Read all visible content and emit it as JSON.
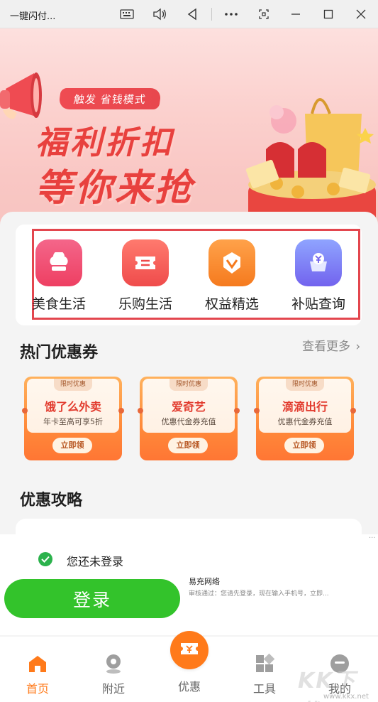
{
  "window": {
    "title": "一键闪付...",
    "buttons": [
      "keyboard-icon",
      "volume-icon",
      "back-icon",
      "more-icon",
      "screen-icon",
      "minimize-icon",
      "maximize-icon",
      "close-icon"
    ]
  },
  "banner": {
    "pill": "触发  省钱模式",
    "headline1": "福利折扣",
    "headline2": "等你来抢"
  },
  "quick_actions": [
    {
      "label": "美食生活",
      "icon": "chef-hat-icon",
      "color": "#f04a6c"
    },
    {
      "label": "乐购生活",
      "icon": "ticket-icon",
      "color": "#f25a54"
    },
    {
      "label": "权益精选",
      "icon": "badge-icon",
      "color": "#f7852a"
    },
    {
      "label": "补贴查询",
      "icon": "yuan-wallet-icon",
      "color": "#7a84f5"
    }
  ],
  "hot_coupons": {
    "title": "热门优惠券",
    "more": "查看更多",
    "items": [
      {
        "tag": "限时优惠",
        "name": "饿了么外卖",
        "desc": "年卡至高可享5折",
        "button": "立即领"
      },
      {
        "tag": "限时优惠",
        "name": "爱奇艺",
        "desc": "优惠代金券充值",
        "button": "立即领"
      },
      {
        "tag": "限时优惠",
        "name": "滴滴出行",
        "desc": "优惠代金券充值",
        "button": "立即领"
      }
    ]
  },
  "guide": {
    "title": "优惠攻略"
  },
  "login": {
    "status": "您还未登录",
    "button": "登录",
    "carrier": "易充网络",
    "note": "审核通过：您请先登录，现在输入手机号，立即..."
  },
  "tabs": [
    {
      "label": "首页",
      "icon": "home-icon",
      "active": true
    },
    {
      "label": "附近",
      "icon": "location-icon",
      "active": false
    },
    {
      "label": "优惠",
      "icon": "coupon-icon",
      "active": false
    },
    {
      "label": "工具",
      "icon": "grid-icon",
      "active": false
    },
    {
      "label": "我的",
      "icon": "profile-icon",
      "active": false
    }
  ],
  "watermark": {
    "text": "KK下载",
    "url": "www.kkx.net"
  },
  "colors": {
    "accent": "#ff7a1a",
    "login_green": "#33c32b",
    "highlight_red": "#e3464e"
  }
}
